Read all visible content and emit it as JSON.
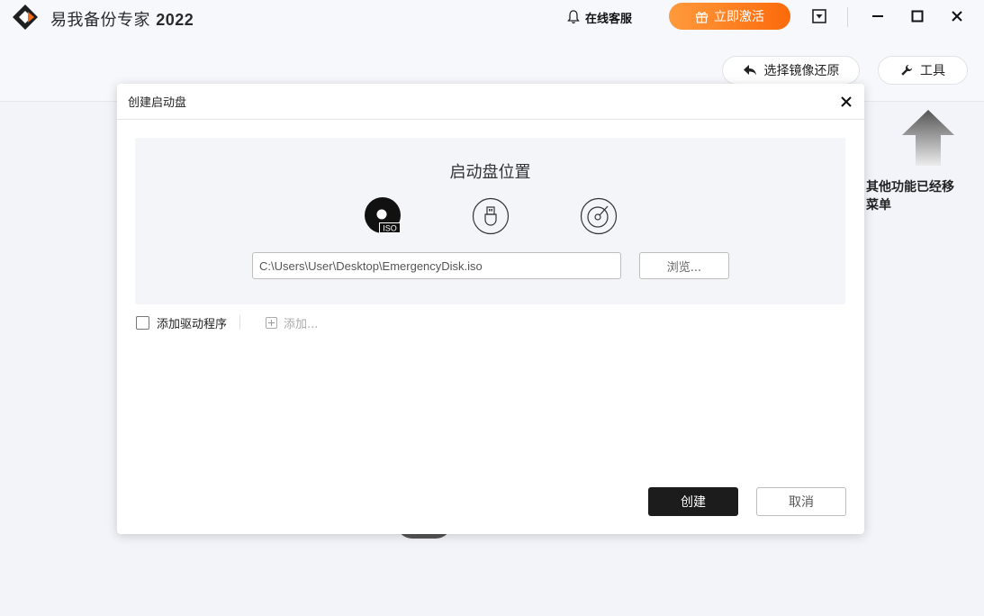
{
  "app": {
    "title": "易我备份专家",
    "year": "2022",
    "brand_color": "#f26b1d"
  },
  "header": {
    "support_label": "在线客服",
    "activate_label": "立即激活",
    "activate_color": "#fb7a1a",
    "restore_label": "选择镜像还原",
    "tools_label": "工具"
  },
  "background": {
    "hint_text": "其他功能已经移\n菜单"
  },
  "dialog": {
    "title": "创建启动盘",
    "section_title": "启动盘位置",
    "options": [
      {
        "name": "iso",
        "icon": "iso-disc-icon",
        "label": "ISO",
        "selected": true
      },
      {
        "name": "usb",
        "icon": "usb-drive-icon",
        "selected": false
      },
      {
        "name": "cd",
        "icon": "cd-disc-icon",
        "selected": false
      }
    ],
    "path_value": "C:\\Users\\User\\Desktop\\EmergencyDisk.iso",
    "browse_label": "浏览...",
    "add_driver_label": "添加驱动程序",
    "add_driver_checked": false,
    "add_label": "添加...",
    "create_label": "创建",
    "cancel_label": "取消"
  }
}
